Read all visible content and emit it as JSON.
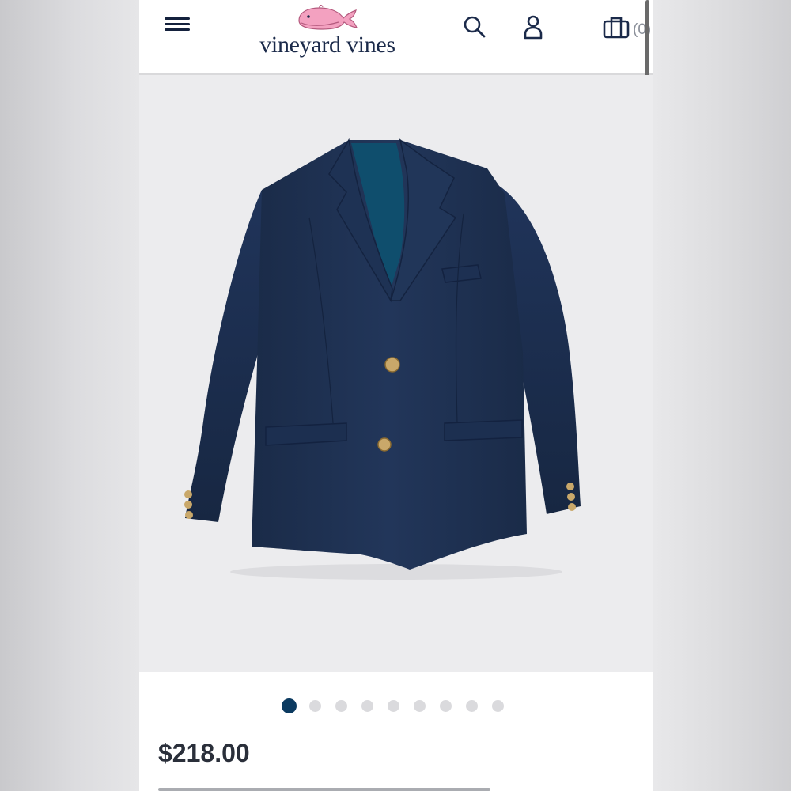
{
  "header": {
    "brand": "vineyard vines",
    "bag_count": "(0)",
    "icons": {
      "menu": "hamburger-menu-icon",
      "search": "search-icon",
      "account": "user-icon",
      "bag": "shopping-bag-icon"
    }
  },
  "product": {
    "image_subject": "navy-blazer",
    "price": "$218.00",
    "carousel": {
      "total": 9,
      "active": 1
    }
  },
  "colors": {
    "brand_navy": "#1b2a4a",
    "active_dot": "#0b3a60",
    "whale_pink": "#f3a1c0",
    "blazer_navy": "#1d2f4e"
  }
}
